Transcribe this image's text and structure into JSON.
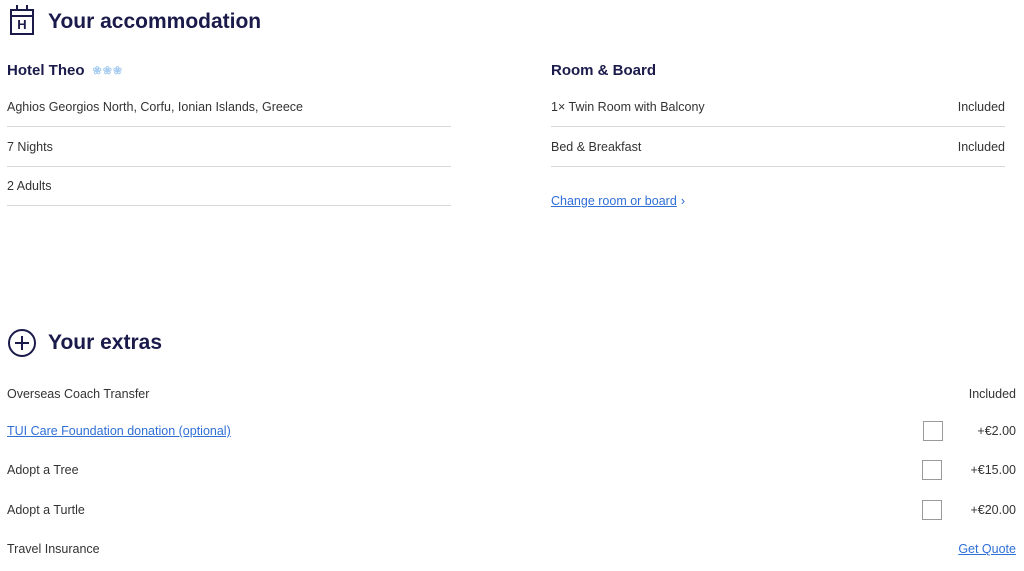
{
  "accommodation": {
    "title": "Your accommodation",
    "hotel": {
      "name": "Hotel Theo",
      "stars": "❀❀❀",
      "location": "Aghios Georgios North, Corfu, Ionian Islands, Greece",
      "nights": "7 Nights",
      "guests": "2  Adults"
    },
    "room_board": {
      "title": "Room & Board",
      "items": [
        {
          "label": "1× Twin Room with Balcony",
          "status": "Included"
        },
        {
          "label": "Bed & Breakfast",
          "status": "Included"
        }
      ],
      "change_link": "Change room or board",
      "chevron": "›"
    }
  },
  "extras": {
    "title": "Your extras",
    "items": [
      {
        "label": "Overseas Coach Transfer",
        "value": "Included"
      },
      {
        "label": "TUI Care Foundation donation (optional)",
        "price": "+€2.00",
        "checked": false
      },
      {
        "label": "Adopt a Tree",
        "price": "+€15.00",
        "checked": false
      },
      {
        "label": "Adopt a Turtle",
        "price": "+€20.00",
        "checked": false
      },
      {
        "label": "Travel Insurance",
        "action": "Get Quote"
      }
    ]
  },
  "colors": {
    "heading": "#1a1a4b",
    "link": "#2f6fd6",
    "stars": "#a8cdf0",
    "divider": "#d9d9d9"
  },
  "icons": {
    "accommodation": "hotel-icon",
    "extras": "plus-circle-icon",
    "checkbox": "checkbox",
    "chevron": "chevron-right-icon"
  }
}
